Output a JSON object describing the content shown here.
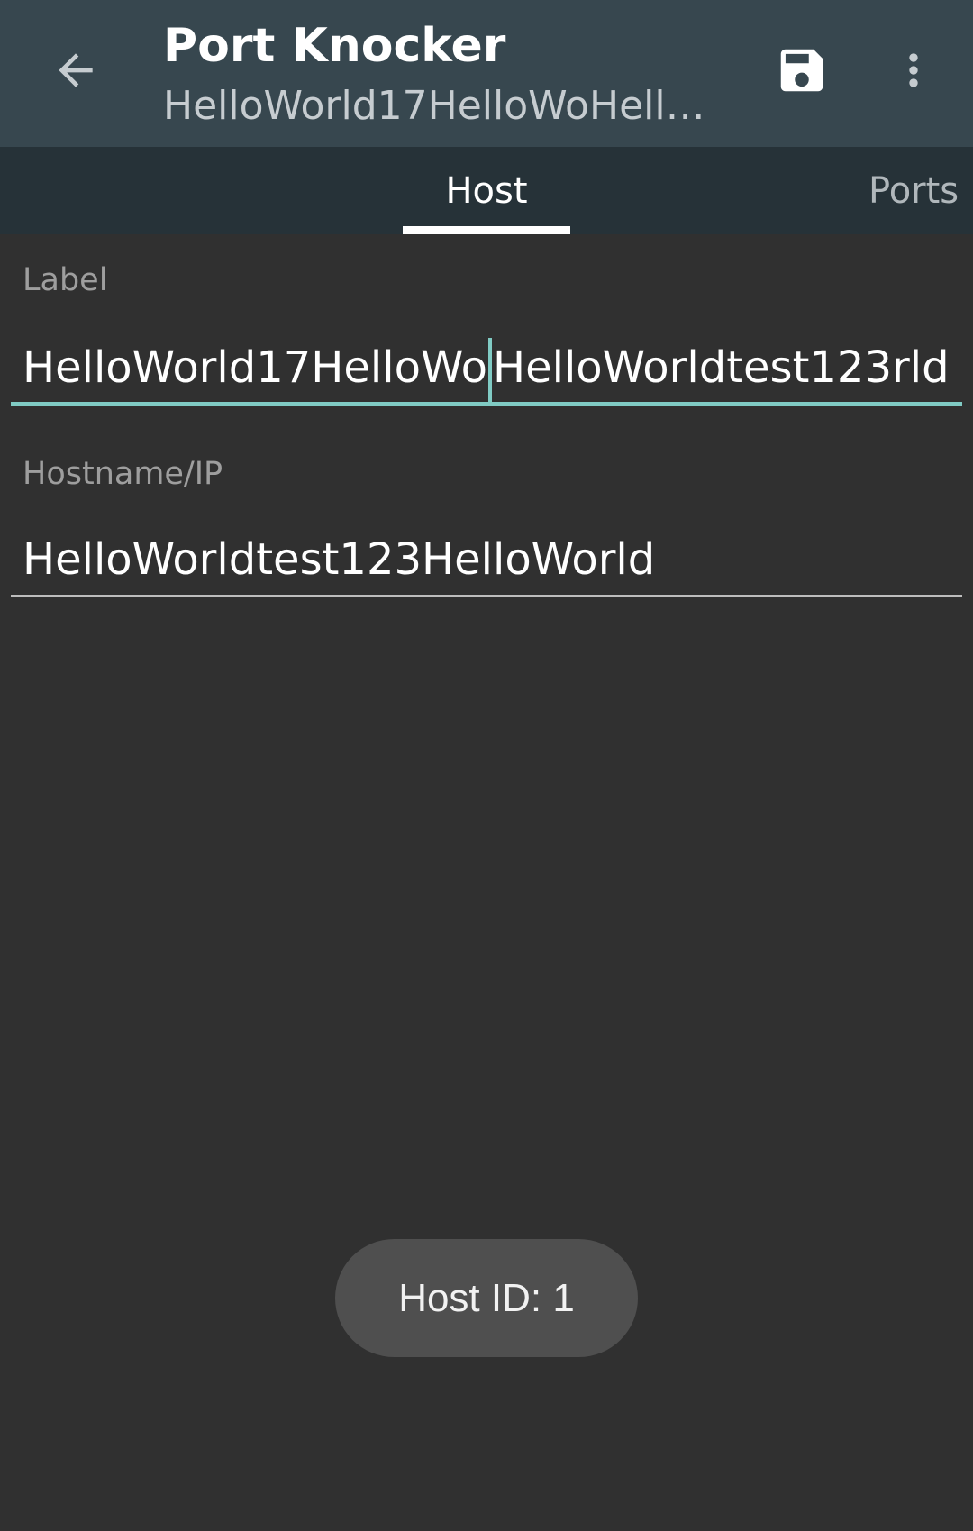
{
  "toolbar": {
    "title": "Port Knocker",
    "subtitle": "HelloWorld17HelloWoHello…",
    "back_icon": "arrow-back-icon",
    "save_icon": "save-icon",
    "overflow_icon": "more-vert-icon"
  },
  "tabs": [
    {
      "label": "Host",
      "selected": true
    },
    {
      "label": "Ports",
      "selected": false
    }
  ],
  "form": {
    "label": {
      "caption": "Label",
      "value_before_cursor": "HelloWorld17HelloWo",
      "value_after_cursor": "HelloWorldtest123rld",
      "focused": true
    },
    "hostname": {
      "caption": "Hostname/IP",
      "value": "HelloWorldtest123HelloWorld"
    }
  },
  "toast": {
    "text": "Host ID: 1"
  },
  "colors": {
    "toolbar": "#37474f",
    "tabbar": "#263238",
    "background": "#303030",
    "accent": "#80cbc4",
    "toast": "#4f4f4f"
  }
}
